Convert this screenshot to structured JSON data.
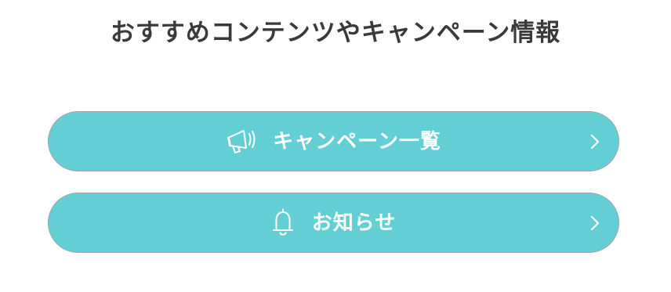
{
  "section": {
    "title": "おすすめコンテンツやキャンペーン情報"
  },
  "buttons": [
    {
      "label": "キャンペーン一覧",
      "icon": "megaphone-icon"
    },
    {
      "label": "お知らせ",
      "icon": "bell-icon"
    }
  ],
  "colors": {
    "title_text": "#3a3a3a",
    "button_background": "#63cfd5",
    "button_border": "#a3a3a3",
    "button_text": "#ffffff"
  }
}
